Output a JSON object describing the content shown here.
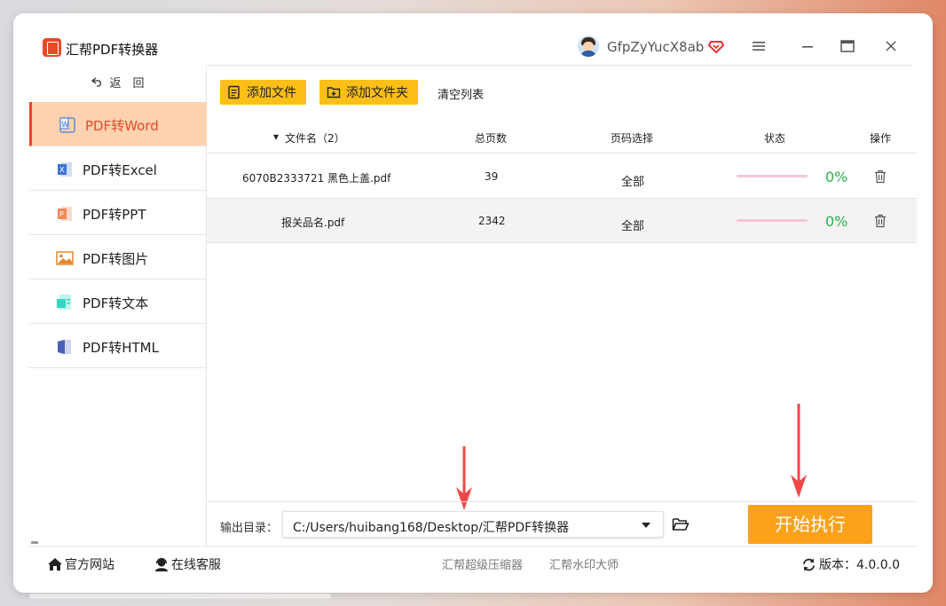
{
  "app": {
    "title": "汇帮PDF转换器",
    "username": "GfpZyYucX8ab"
  },
  "sidebar": {
    "back_label": "返　回",
    "items": [
      {
        "label": "PDF转Word",
        "icon": "word-icon",
        "color": "#4a7bd6"
      },
      {
        "label": "PDF转Excel",
        "icon": "excel-icon",
        "color": "#3f74d4"
      },
      {
        "label": "PDF转PPT",
        "icon": "ppt-icon",
        "color": "#f08a5d"
      },
      {
        "label": "PDF转图片",
        "icon": "image-icon",
        "color": "#e0872b"
      },
      {
        "label": "PDF转文本",
        "icon": "text-icon",
        "color": "#2fd7c4"
      },
      {
        "label": "PDF转HTML",
        "icon": "html-icon",
        "color": "#4a5fb8"
      }
    ],
    "active_index": 0
  },
  "toolbar": {
    "add_file": "添加文件",
    "add_folder": "添加文件夹",
    "clear_list": "清空列表"
  },
  "table": {
    "headers": {
      "filename": "文件名（2）",
      "pages": "总页数",
      "range": "页码选择",
      "status": "状态",
      "action": "操作"
    },
    "rows": [
      {
        "filename": "6070B2333721 黑色上盖.pdf",
        "pages": "39",
        "range": "全部",
        "progress": "0%"
      },
      {
        "filename": "报关品名.pdf",
        "pages": "2342",
        "range": "全部",
        "progress": "0%"
      }
    ]
  },
  "output": {
    "label": "输出目录：",
    "path": "C:/Users/huibang168/Desktop/汇帮PDF转换器"
  },
  "start_button": "开始执行",
  "footer": {
    "website": "官方网站",
    "support": "在线客服",
    "link1": "汇帮超级压缩器",
    "link2": "汇帮水印大师",
    "version": "版本：4.0.0.0"
  },
  "colors": {
    "accent": "#e8492b",
    "button_yellow": "#fbbf18",
    "start_orange": "#fba11a",
    "progress_green": "#2bb24c",
    "arrow_red": "#f0484a"
  }
}
